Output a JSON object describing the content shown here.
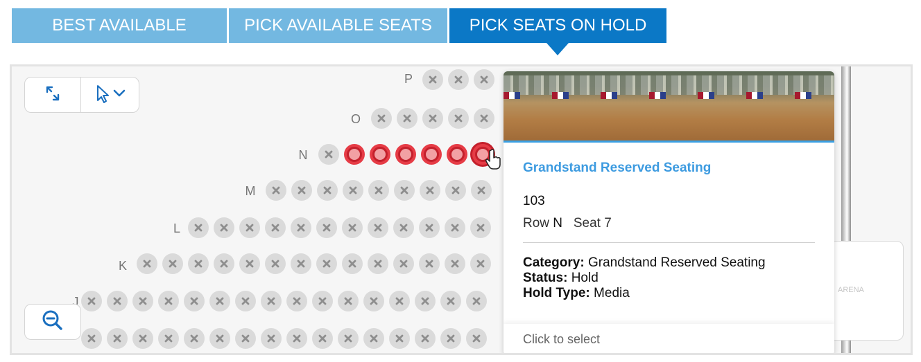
{
  "tabs": [
    {
      "label": "BEST AVAILABLE"
    },
    {
      "label": "PICK AVAILABLE SEATS"
    },
    {
      "label": "PICK SEATS ON HOLD"
    }
  ],
  "rows": {
    "P": "P",
    "O": "O",
    "N": "N",
    "M": "M",
    "L": "L",
    "K": "K",
    "J": "J"
  },
  "popup": {
    "section_name": "Grandstand Reserved Seating",
    "section_number": "103",
    "row_label": "Row",
    "row_value": "N",
    "seat_label": "Seat",
    "seat_value": "7",
    "category_label": "Category:",
    "category_value": "Grandstand Reserved Seating",
    "status_label": "Status:",
    "status_value": "Hold",
    "hold_type_label": "Hold Type:",
    "hold_type_value": "Media",
    "footer": "Click to select"
  },
  "minimap": {
    "label": "ARENA"
  },
  "icons": {
    "expand": "expand-icon",
    "cursor": "cursor-arrow-icon",
    "chevron": "chevron-down-icon",
    "zoom_out": "zoom-out-icon",
    "hand": "hand-pointer-icon"
  },
  "colors": {
    "tab_inactive": "#73b8e1",
    "tab_active": "#0b78c6",
    "hold_seat": "#e63c46",
    "section_title": "#3d9be0"
  }
}
